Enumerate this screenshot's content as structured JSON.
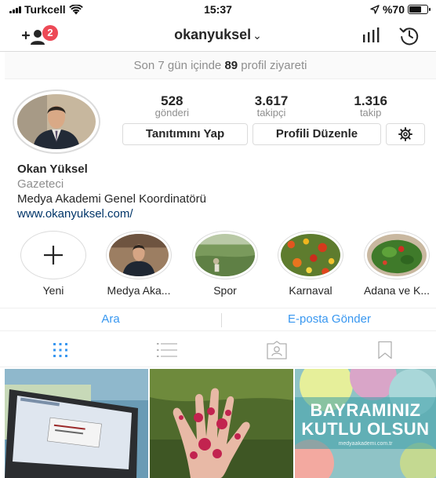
{
  "status_bar": {
    "carrier": "Turkcell",
    "time": "15:37",
    "battery": "%70",
    "battery_level": 0.7
  },
  "nav": {
    "notification_count": "2",
    "username": "okanyuksel",
    "chevron": "⌄"
  },
  "visits": {
    "prefix": "Son 7 gün içinde ",
    "count": "89",
    "suffix": " profil ziyareti"
  },
  "stats": [
    {
      "value": "528",
      "label": "gönderi"
    },
    {
      "value": "3.617",
      "label": "takipçi"
    },
    {
      "value": "1.316",
      "label": "takip"
    }
  ],
  "buttons": {
    "promote": "Tanıtımını Yap",
    "edit_profile": "Profili Düzenle"
  },
  "bio": {
    "name": "Okan Yüksel",
    "category": "Gazeteci",
    "text": "Medya Akademi Genel Koordinatörü",
    "link": "www.okanyuksel.com/"
  },
  "highlights": [
    {
      "label": "Yeni",
      "icon": "plus-icon"
    },
    {
      "label": "Medya Aka...",
      "icon": "portrait-photo"
    },
    {
      "label": "Spor",
      "icon": "field-photo"
    },
    {
      "label": "Karnaval",
      "icon": "flowers-photo"
    },
    {
      "label": "Adana ve K...",
      "icon": "salad-photo"
    }
  ],
  "actions": {
    "search": "Ara",
    "email": "E-posta Gönder"
  },
  "tabs": [
    "grid-icon",
    "list-icon",
    "tagged-icon",
    "saved-icon"
  ],
  "posts": [
    {
      "kind": "laptop-photo"
    },
    {
      "kind": "hand-photo"
    },
    {
      "kind": "greeting-card",
      "line1": "BAYRAMINIZ",
      "line2": "KUTLU OLSUN",
      "line3": "medyaakademi.com.tr"
    }
  ],
  "colors": {
    "accent": "#3897f0",
    "badge": "#ed4956",
    "link": "#003569",
    "muted": "#8e8e8e"
  }
}
